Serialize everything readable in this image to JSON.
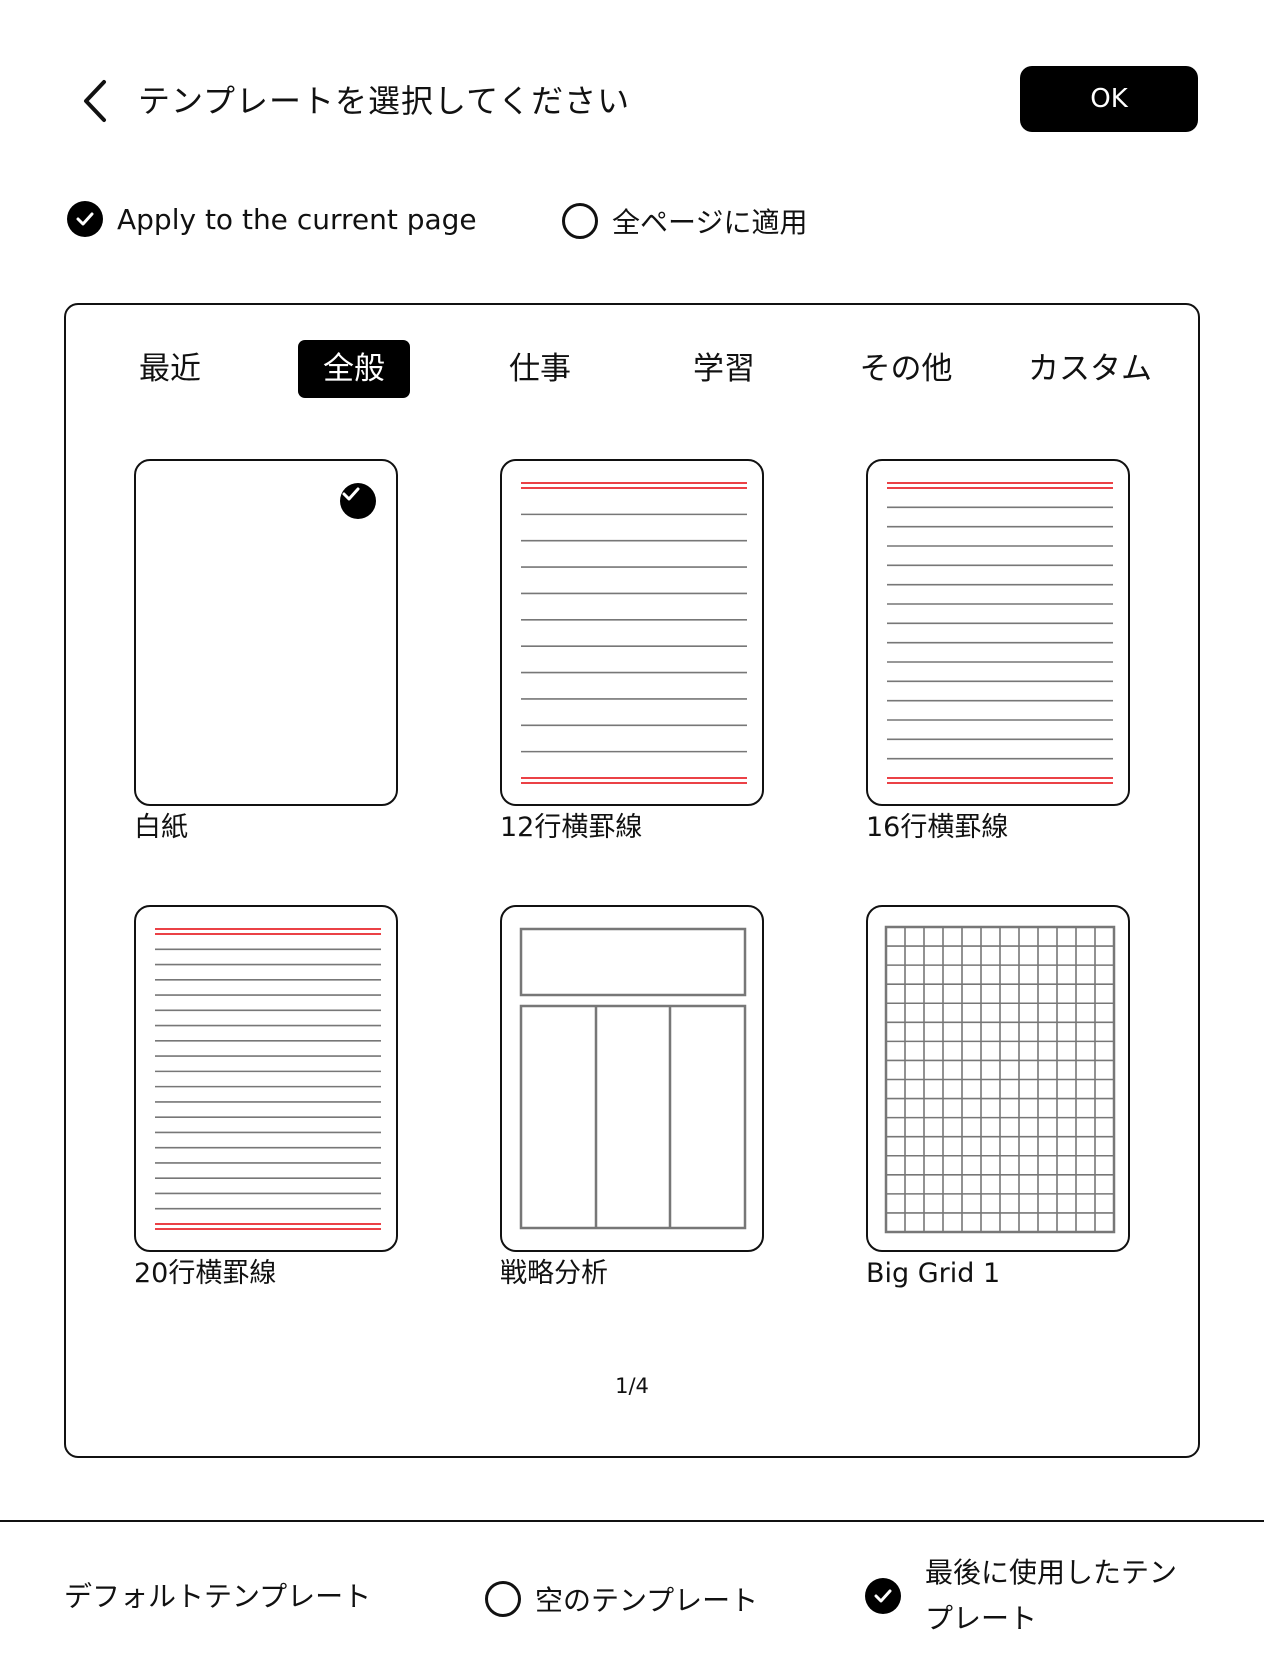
{
  "header": {
    "title": "テンプレートを選択してください",
    "ok_label": "OK"
  },
  "apply": {
    "current_page": "Apply to the current page",
    "all_pages": "全ページに適用",
    "selected": "current_page"
  },
  "tabs": [
    {
      "label": "最近",
      "active": false
    },
    {
      "label": "全般",
      "active": true
    },
    {
      "label": "仕事",
      "active": false
    },
    {
      "label": "学習",
      "active": false
    },
    {
      "label": "その他",
      "active": false
    },
    {
      "label": "カスタム",
      "active": false
    }
  ],
  "templates": [
    {
      "label": "白紙",
      "kind": "blank",
      "selected": true
    },
    {
      "label": "12行横罫線",
      "kind": "lines",
      "lines": 12,
      "selected": false
    },
    {
      "label": "16行横罫線",
      "kind": "lines",
      "lines": 16,
      "selected": false
    },
    {
      "label": "20行横罫線",
      "kind": "lines",
      "lines": 20,
      "selected": false
    },
    {
      "label": "戦略分析",
      "kind": "strategy",
      "selected": false
    },
    {
      "label": "Big Grid 1",
      "kind": "grid",
      "selected": false
    }
  ],
  "pager": "1/4",
  "default_template": {
    "label": "デフォルトテンプレート",
    "empty": "空のテンプレート",
    "last_used": "最後に使用したテンプレート",
    "selected": "last_used"
  },
  "colors": {
    "accent_red": "#e8262b",
    "line_gray": "#777777",
    "ink": "#000000"
  }
}
